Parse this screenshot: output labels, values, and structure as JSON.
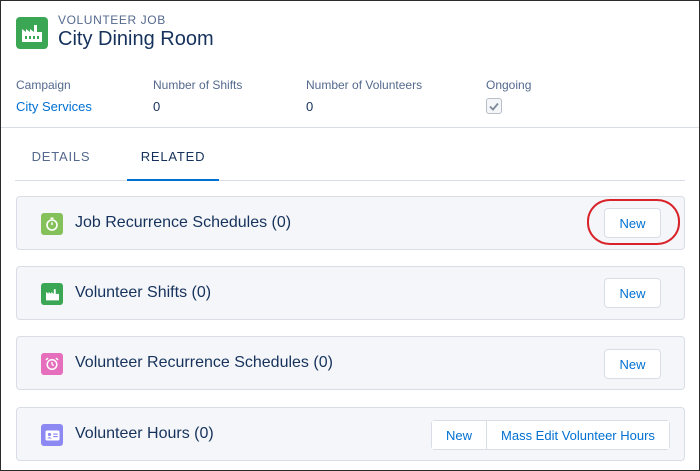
{
  "record": {
    "object_type": "Volunteer Job",
    "title": "City Dining Room",
    "icon": "factory-icon",
    "icon_color": "#3ba755"
  },
  "fields": [
    {
      "label": "Campaign",
      "value": "City Services",
      "is_link": true
    },
    {
      "label": "Number of Shifts",
      "value": "0"
    },
    {
      "label": "Number of Volunteers",
      "value": "0"
    },
    {
      "label": "Ongoing",
      "checked": true
    }
  ],
  "tabs": [
    {
      "label": "DETAILS",
      "active": false
    },
    {
      "label": "RELATED",
      "active": true
    }
  ],
  "related_lists": [
    {
      "title": "Job Recurrence Schedules (0)",
      "icon": "stopwatch-icon",
      "icon_color": "#84c15a",
      "buttons": [
        "New"
      ],
      "highlighted": true
    },
    {
      "title": "Volunteer Shifts (0)",
      "icon": "factory-icon",
      "icon_color": "#3ba755",
      "buttons": [
        "New"
      ]
    },
    {
      "title": "Volunteer Recurrence Schedules (0)",
      "icon": "alarm-clock-icon",
      "icon_color": "#e56fbc",
      "buttons": [
        "New"
      ]
    },
    {
      "title": "Volunteer Hours (0)",
      "icon": "contact-card-icon",
      "icon_color": "#8c89f2",
      "buttons": [
        "New",
        "Mass Edit Volunteer Hours"
      ]
    }
  ],
  "colors": {
    "link": "#0070d2",
    "highlight_ring": "#d8232a"
  }
}
